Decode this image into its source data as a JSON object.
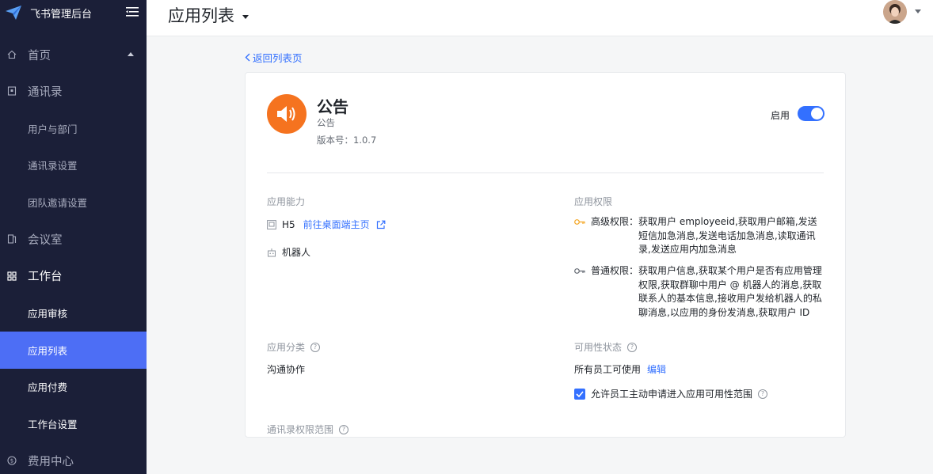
{
  "app": {
    "title": "飞书管理后台",
    "page_title": "应用列表"
  },
  "sidebar": {
    "items": [
      {
        "label": "首页"
      },
      {
        "label": "通讯录"
      },
      {
        "label": "用户与部门"
      },
      {
        "label": "通讯录设置"
      },
      {
        "label": "团队邀请设置"
      },
      {
        "label": "会议室"
      },
      {
        "label": "工作台"
      },
      {
        "label": "应用审核"
      },
      {
        "label": "应用列表"
      },
      {
        "label": "应用付费"
      },
      {
        "label": "工作台设置"
      },
      {
        "label": "费用中心"
      }
    ]
  },
  "main": {
    "back_label": "返回列表页",
    "app_name": "公告",
    "app_subtitle": "公告",
    "app_version": "版本号：1.0.7",
    "enable_label": "启用",
    "enabled": true,
    "capabilities_title": "应用能力",
    "capabilities": [
      {
        "name": "H5",
        "link": "前往桌面端主页",
        "icon": "h5-icon"
      },
      {
        "name": "机器人",
        "icon": "robot-icon"
      }
    ],
    "permissions_title": "应用权限",
    "permissions": [
      {
        "name": "高级权限：",
        "desc": "获取用户 employeeid,获取用户邮箱,发送短信加急消息,发送电话加急消息,读取通讯录,发送应用内加急消息",
        "color": "#f5a623"
      },
      {
        "name": "普通权限：",
        "desc": "获取用户信息,获取某个用户是否有应用管理权限,获取群聊中用户 @ 机器人的消息,获取联系人的基本信息,接收用户发给机器人的私聊消息,以应用的身份发消息,获取用户 ID",
        "color": "#646a73"
      }
    ],
    "category_title": "应用分类",
    "category_value": "沟通协作",
    "availability_title": "可用性状态",
    "availability_value": "所有员工可使用",
    "availability_edit": "编辑",
    "checkbox_label": "允许员工主动申请进入应用可用性范围",
    "checkbox_checked": true,
    "contact_scope_title": "通讯录权限范围"
  },
  "colors": {
    "sidebar_bg": "#1b1f38",
    "accent": "#3370ff",
    "active_item": "#4d6ef5",
    "app_icon": "#f5731f"
  }
}
